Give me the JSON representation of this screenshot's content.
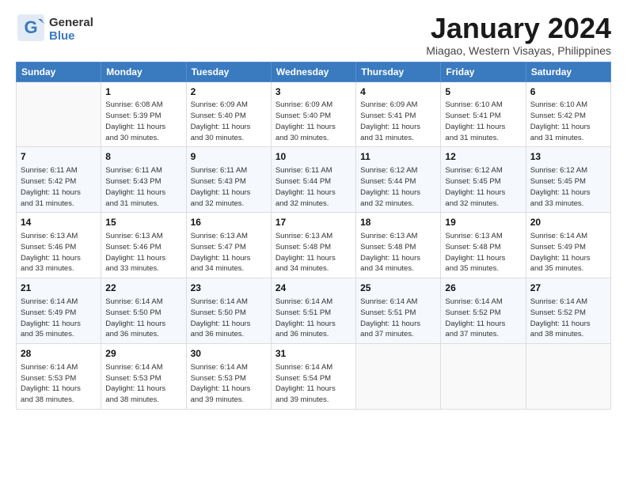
{
  "logo": {
    "general": "General",
    "blue": "Blue"
  },
  "title": "January 2024",
  "location": "Miagao, Western Visayas, Philippines",
  "headers": [
    "Sunday",
    "Monday",
    "Tuesday",
    "Wednesday",
    "Thursday",
    "Friday",
    "Saturday"
  ],
  "weeks": [
    [
      {
        "day": "",
        "lines": []
      },
      {
        "day": "1",
        "lines": [
          "Sunrise: 6:08 AM",
          "Sunset: 5:39 PM",
          "Daylight: 11 hours",
          "and 30 minutes."
        ]
      },
      {
        "day": "2",
        "lines": [
          "Sunrise: 6:09 AM",
          "Sunset: 5:40 PM",
          "Daylight: 11 hours",
          "and 30 minutes."
        ]
      },
      {
        "day": "3",
        "lines": [
          "Sunrise: 6:09 AM",
          "Sunset: 5:40 PM",
          "Daylight: 11 hours",
          "and 30 minutes."
        ]
      },
      {
        "day": "4",
        "lines": [
          "Sunrise: 6:09 AM",
          "Sunset: 5:41 PM",
          "Daylight: 11 hours",
          "and 31 minutes."
        ]
      },
      {
        "day": "5",
        "lines": [
          "Sunrise: 6:10 AM",
          "Sunset: 5:41 PM",
          "Daylight: 11 hours",
          "and 31 minutes."
        ]
      },
      {
        "day": "6",
        "lines": [
          "Sunrise: 6:10 AM",
          "Sunset: 5:42 PM",
          "Daylight: 11 hours",
          "and 31 minutes."
        ]
      }
    ],
    [
      {
        "day": "7",
        "lines": [
          "Sunrise: 6:11 AM",
          "Sunset: 5:42 PM",
          "Daylight: 11 hours",
          "and 31 minutes."
        ]
      },
      {
        "day": "8",
        "lines": [
          "Sunrise: 6:11 AM",
          "Sunset: 5:43 PM",
          "Daylight: 11 hours",
          "and 31 minutes."
        ]
      },
      {
        "day": "9",
        "lines": [
          "Sunrise: 6:11 AM",
          "Sunset: 5:43 PM",
          "Daylight: 11 hours",
          "and 32 minutes."
        ]
      },
      {
        "day": "10",
        "lines": [
          "Sunrise: 6:11 AM",
          "Sunset: 5:44 PM",
          "Daylight: 11 hours",
          "and 32 minutes."
        ]
      },
      {
        "day": "11",
        "lines": [
          "Sunrise: 6:12 AM",
          "Sunset: 5:44 PM",
          "Daylight: 11 hours",
          "and 32 minutes."
        ]
      },
      {
        "day": "12",
        "lines": [
          "Sunrise: 6:12 AM",
          "Sunset: 5:45 PM",
          "Daylight: 11 hours",
          "and 32 minutes."
        ]
      },
      {
        "day": "13",
        "lines": [
          "Sunrise: 6:12 AM",
          "Sunset: 5:45 PM",
          "Daylight: 11 hours",
          "and 33 minutes."
        ]
      }
    ],
    [
      {
        "day": "14",
        "lines": [
          "Sunrise: 6:13 AM",
          "Sunset: 5:46 PM",
          "Daylight: 11 hours",
          "and 33 minutes."
        ]
      },
      {
        "day": "15",
        "lines": [
          "Sunrise: 6:13 AM",
          "Sunset: 5:46 PM",
          "Daylight: 11 hours",
          "and 33 minutes."
        ]
      },
      {
        "day": "16",
        "lines": [
          "Sunrise: 6:13 AM",
          "Sunset: 5:47 PM",
          "Daylight: 11 hours",
          "and 34 minutes."
        ]
      },
      {
        "day": "17",
        "lines": [
          "Sunrise: 6:13 AM",
          "Sunset: 5:48 PM",
          "Daylight: 11 hours",
          "and 34 minutes."
        ]
      },
      {
        "day": "18",
        "lines": [
          "Sunrise: 6:13 AM",
          "Sunset: 5:48 PM",
          "Daylight: 11 hours",
          "and 34 minutes."
        ]
      },
      {
        "day": "19",
        "lines": [
          "Sunrise: 6:13 AM",
          "Sunset: 5:48 PM",
          "Daylight: 11 hours",
          "and 35 minutes."
        ]
      },
      {
        "day": "20",
        "lines": [
          "Sunrise: 6:14 AM",
          "Sunset: 5:49 PM",
          "Daylight: 11 hours",
          "and 35 minutes."
        ]
      }
    ],
    [
      {
        "day": "21",
        "lines": [
          "Sunrise: 6:14 AM",
          "Sunset: 5:49 PM",
          "Daylight: 11 hours",
          "and 35 minutes."
        ]
      },
      {
        "day": "22",
        "lines": [
          "Sunrise: 6:14 AM",
          "Sunset: 5:50 PM",
          "Daylight: 11 hours",
          "and 36 minutes."
        ]
      },
      {
        "day": "23",
        "lines": [
          "Sunrise: 6:14 AM",
          "Sunset: 5:50 PM",
          "Daylight: 11 hours",
          "and 36 minutes."
        ]
      },
      {
        "day": "24",
        "lines": [
          "Sunrise: 6:14 AM",
          "Sunset: 5:51 PM",
          "Daylight: 11 hours",
          "and 36 minutes."
        ]
      },
      {
        "day": "25",
        "lines": [
          "Sunrise: 6:14 AM",
          "Sunset: 5:51 PM",
          "Daylight: 11 hours",
          "and 37 minutes."
        ]
      },
      {
        "day": "26",
        "lines": [
          "Sunrise: 6:14 AM",
          "Sunset: 5:52 PM",
          "Daylight: 11 hours",
          "and 37 minutes."
        ]
      },
      {
        "day": "27",
        "lines": [
          "Sunrise: 6:14 AM",
          "Sunset: 5:52 PM",
          "Daylight: 11 hours",
          "and 38 minutes."
        ]
      }
    ],
    [
      {
        "day": "28",
        "lines": [
          "Sunrise: 6:14 AM",
          "Sunset: 5:53 PM",
          "Daylight: 11 hours",
          "and 38 minutes."
        ]
      },
      {
        "day": "29",
        "lines": [
          "Sunrise: 6:14 AM",
          "Sunset: 5:53 PM",
          "Daylight: 11 hours",
          "and 38 minutes."
        ]
      },
      {
        "day": "30",
        "lines": [
          "Sunrise: 6:14 AM",
          "Sunset: 5:53 PM",
          "Daylight: 11 hours",
          "and 39 minutes."
        ]
      },
      {
        "day": "31",
        "lines": [
          "Sunrise: 6:14 AM",
          "Sunset: 5:54 PM",
          "Daylight: 11 hours",
          "and 39 minutes."
        ]
      },
      {
        "day": "",
        "lines": []
      },
      {
        "day": "",
        "lines": []
      },
      {
        "day": "",
        "lines": []
      }
    ]
  ]
}
